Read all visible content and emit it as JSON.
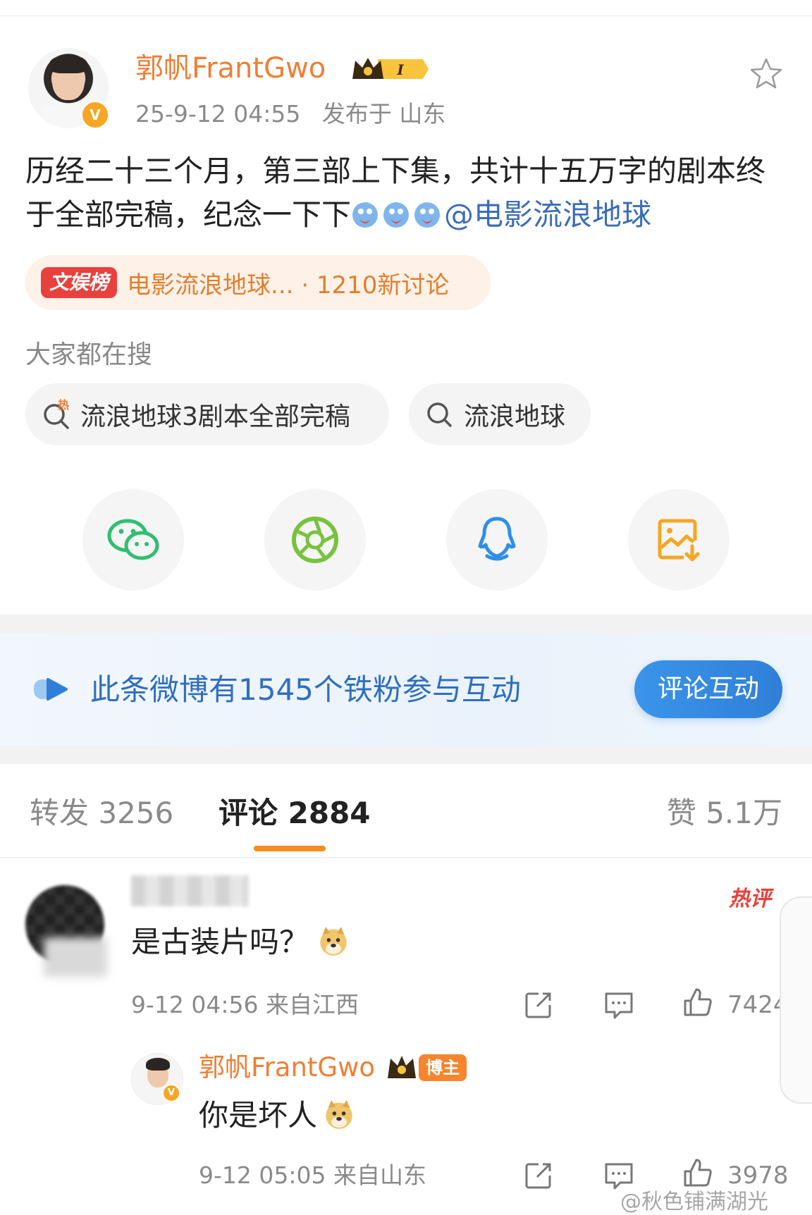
{
  "post": {
    "author": "郭帆FrantGwo",
    "level": "I",
    "time": "25-9-12 04:55",
    "location": "发布于 山东",
    "text": "历经二十三个月，第三部上下集，共计十五万字的剧本终于全部完稿，纪念一下下",
    "mention": "@电影流浪地球"
  },
  "hot": {
    "tag": "文娱榜",
    "text": "电影流浪地球... · 1210新讨论"
  },
  "search": {
    "heading": "大家都在搜",
    "chips": [
      "流浪地球3剧本全部完稿",
      "流浪地球"
    ]
  },
  "share": {
    "icons": [
      "wechat-icon",
      "moments-icon",
      "qq-icon",
      "save-image-icon"
    ]
  },
  "fans": {
    "text": "此条微博有1545个铁粉参与互动",
    "button": "评论互动"
  },
  "tabs": {
    "repost": "转发 3256",
    "comment": "评论 2884",
    "like": "赞 5.1万"
  },
  "comments": [
    {
      "badge": "热评",
      "text": "是古装片吗？",
      "meta": "9-12 04:56 来自江西",
      "likes": "7424"
    }
  ],
  "reply": {
    "author": "郭帆FrantGwo",
    "badge": "博主",
    "text": "你是坏人",
    "meta": "9-12 05:05 来自山东",
    "likes": "3978"
  },
  "watermark": "@秋色铺满湖光",
  "colors": {
    "accent": "#f07e34",
    "link": "#3c6db8",
    "hot_red": "#e8413d",
    "blue_button": "#2f7fd8"
  }
}
